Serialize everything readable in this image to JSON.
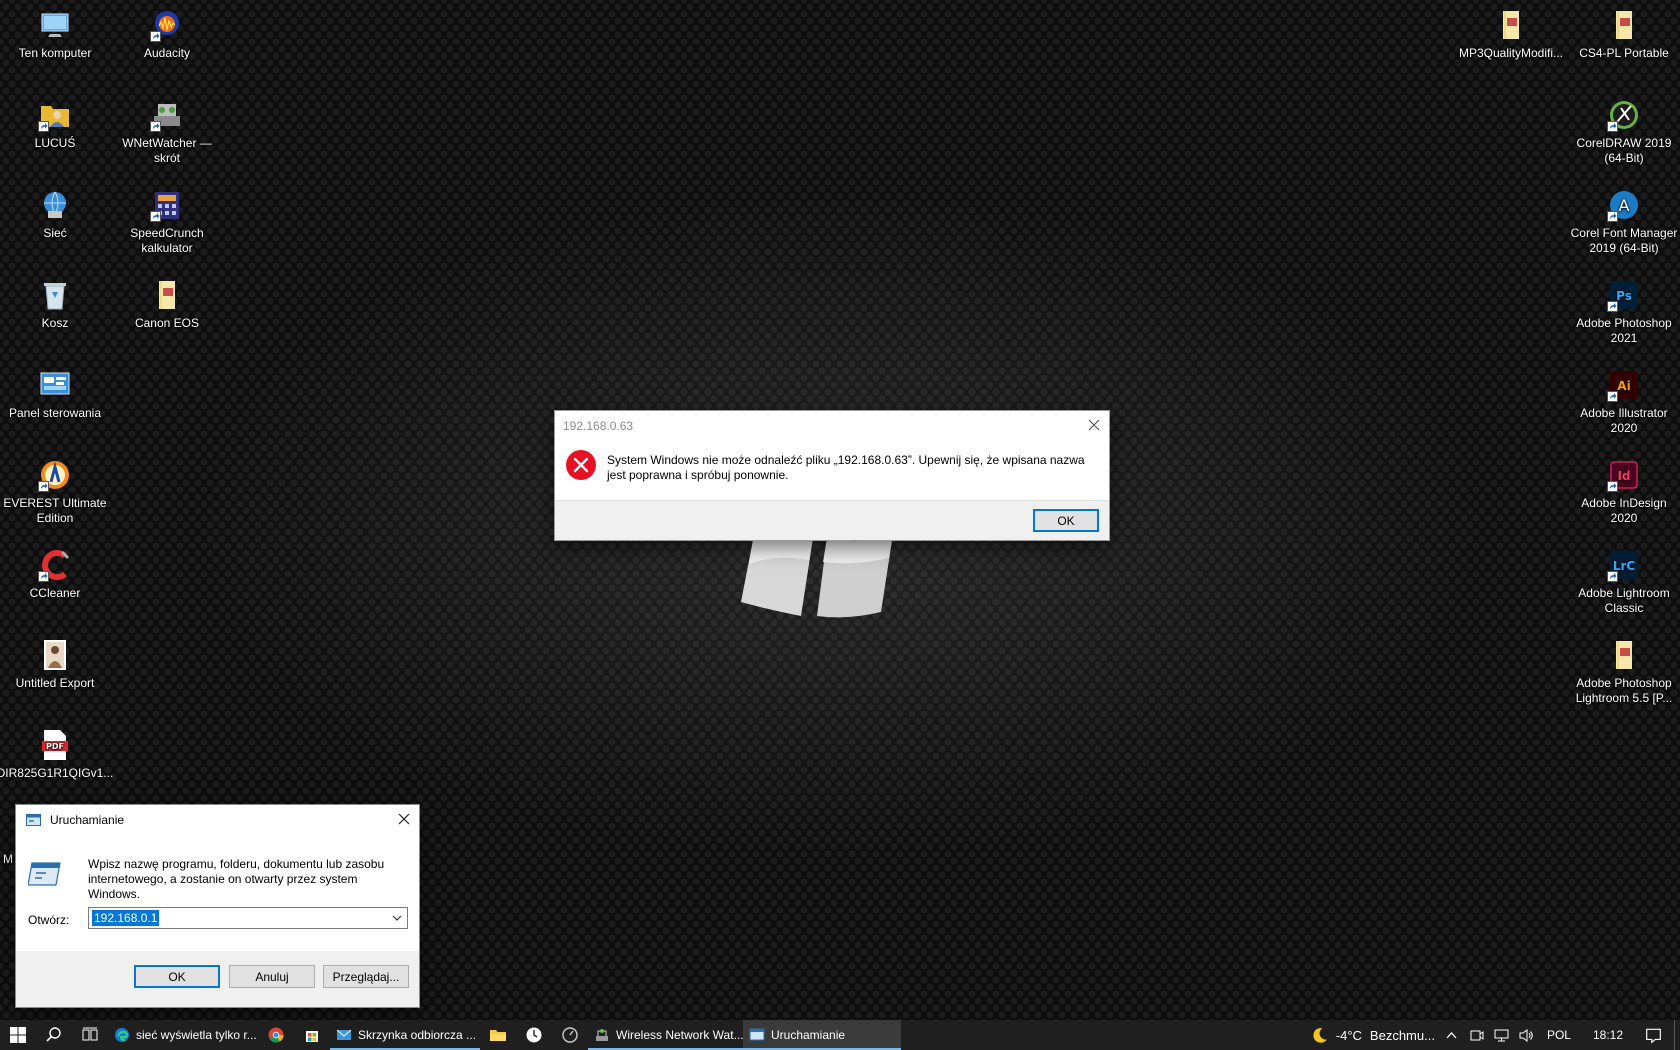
{
  "desktop": {
    "left_col1": [
      {
        "label": "Ten komputer",
        "icon": "computer-icon"
      },
      {
        "label": "LUCUŚ",
        "icon": "folder-user-icon"
      },
      {
        "label": "Sieć",
        "icon": "network-icon"
      },
      {
        "label": "Kosz",
        "icon": "recycle-bin-icon"
      },
      {
        "label": "Panel sterowania",
        "icon": "control-panel-icon"
      },
      {
        "label": "EVEREST Ultimate Edition",
        "icon": "everest-icon"
      },
      {
        "label": "CCleaner",
        "icon": "ccleaner-icon"
      },
      {
        "label": "Untitled Export",
        "icon": "image-file-icon"
      },
      {
        "label": "DIR825G1R1QIGv1...",
        "icon": "pdf-icon"
      }
    ],
    "left_col2": [
      {
        "label": "Audacity",
        "icon": "audacity-icon"
      },
      {
        "label": "WNetWatcher — skrót",
        "icon": "wnetwatcher-icon"
      },
      {
        "label": "SpeedCrunch kalkulator",
        "icon": "speedcrunch-icon"
      },
      {
        "label": "Canon EOS",
        "icon": "folder-icon"
      }
    ],
    "right_col1": [
      {
        "label": "MP3QualityModifi...",
        "icon": "folder-icon"
      }
    ],
    "right_col2": [
      {
        "label": "CS4-PL Portable",
        "icon": "folder-icon"
      },
      {
        "label": "CorelDRAW 2019 (64-Bit)",
        "icon": "coreldraw-icon"
      },
      {
        "label": "Corel Font Manager 2019 (64-Bit)",
        "icon": "corel-font-icon"
      },
      {
        "label": "Adobe Photoshop 2021",
        "icon": "photoshop-icon"
      },
      {
        "label": "Adobe Illustrator 2020",
        "icon": "illustrator-icon"
      },
      {
        "label": "Adobe InDesign 2020",
        "icon": "indesign-icon"
      },
      {
        "label": "Adobe Lightroom Classic",
        "icon": "lightroom-icon"
      },
      {
        "label": "Adobe Photoshop Lightroom 5.5 [P...",
        "icon": "folder-icon"
      }
    ],
    "partial_label": "M"
  },
  "error_dialog": {
    "title": "192.168.0.63",
    "message": "System Windows nie może odnaleźć pliku „192.168.0.63”. Upewnij się, że wpisana nazwa jest poprawna i spróbuj ponownie.",
    "ok_label": "OK"
  },
  "run_dialog": {
    "title": "Uruchamianie",
    "description": "Wpisz nazwę programu, folderu, dokumentu lub zasobu internetowego, a zostanie on otwarty przez system Windows.",
    "open_label": "Otwórz:",
    "open_value": "192.168.0.1",
    "ok_label": "OK",
    "cancel_label": "Anuluj",
    "browse_label": "Przeglądaj..."
  },
  "taskbar": {
    "apps": [
      {
        "label": "sieć wyświetla tylko r...",
        "icon": "edge-icon"
      },
      {
        "label": "Skrzynka odbiorcza ...",
        "icon": "mail-icon"
      },
      {
        "label": "Wireless Network Wat...",
        "icon": "wnetwatcher-icon"
      },
      {
        "label": "Uruchamianie",
        "icon": "run-icon"
      }
    ],
    "weather_temp": "-4°C",
    "weather_desc": "Bezchmu...",
    "language": "POL",
    "time": "18:12"
  }
}
